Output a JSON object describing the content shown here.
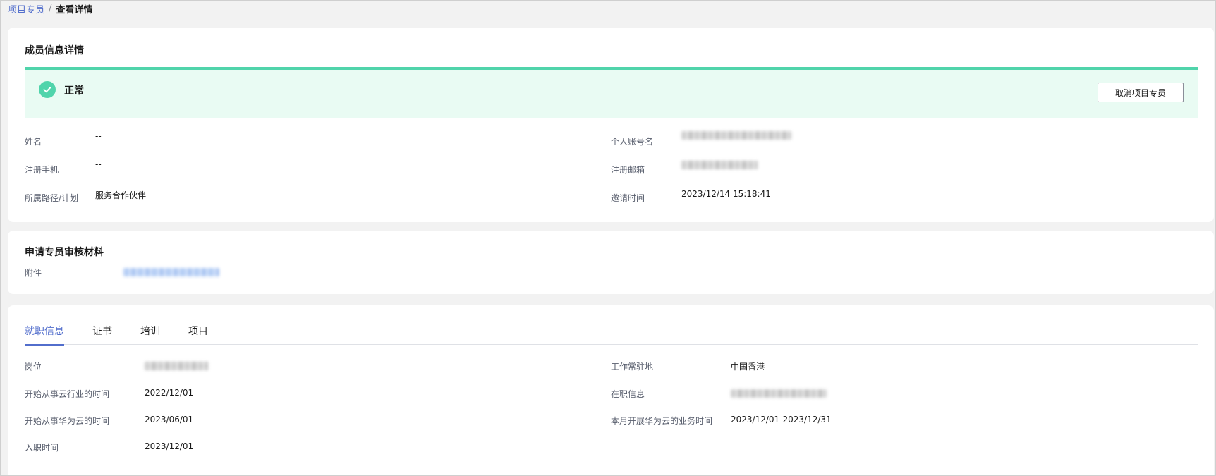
{
  "breadcrumb": {
    "parent": "项目专员",
    "separator": "/",
    "current": "查看详情"
  },
  "member_card": {
    "title": "成员信息详情",
    "status": {
      "text": "正常",
      "icon": "check-circle-icon",
      "color": "#50d4ab"
    },
    "cancel_button": "取消项目专员",
    "fields": {
      "name_label": "姓名",
      "name_value": "--",
      "account_label": "个人账号名",
      "phone_label": "注册手机",
      "phone_value": "--",
      "email_label": "注册邮箱",
      "path_label": "所属路径/计划",
      "path_value": "服务合作伙伴",
      "invite_label": "邀请时间",
      "invite_value": "2023/12/14 15:18:41"
    }
  },
  "materials_card": {
    "title": "申请专员审核材料",
    "attachment_label": "附件"
  },
  "detail_card": {
    "tabs": [
      "就职信息",
      "证书",
      "培训",
      "项目"
    ],
    "active_tab": 0,
    "fields": {
      "position_label": "岗位",
      "cloud_industry_label": "开始从事云行业的时间",
      "cloud_industry_value": "2022/12/01",
      "huawei_cloud_label": "开始从事华为云的时间",
      "huawei_cloud_value": "2023/06/01",
      "join_label": "入职时间",
      "join_value": "2023/12/01",
      "location_label": "工作常驻地",
      "location_value": "中国香港",
      "employment_label": "在职信息",
      "monthly_label": "本月开展华为云的业务时间",
      "monthly_value": "2023/12/01-2023/12/31"
    }
  },
  "colors": {
    "accent": "#526ecc",
    "success": "#50d4ab",
    "banner_bg": "#e9fbf3"
  }
}
